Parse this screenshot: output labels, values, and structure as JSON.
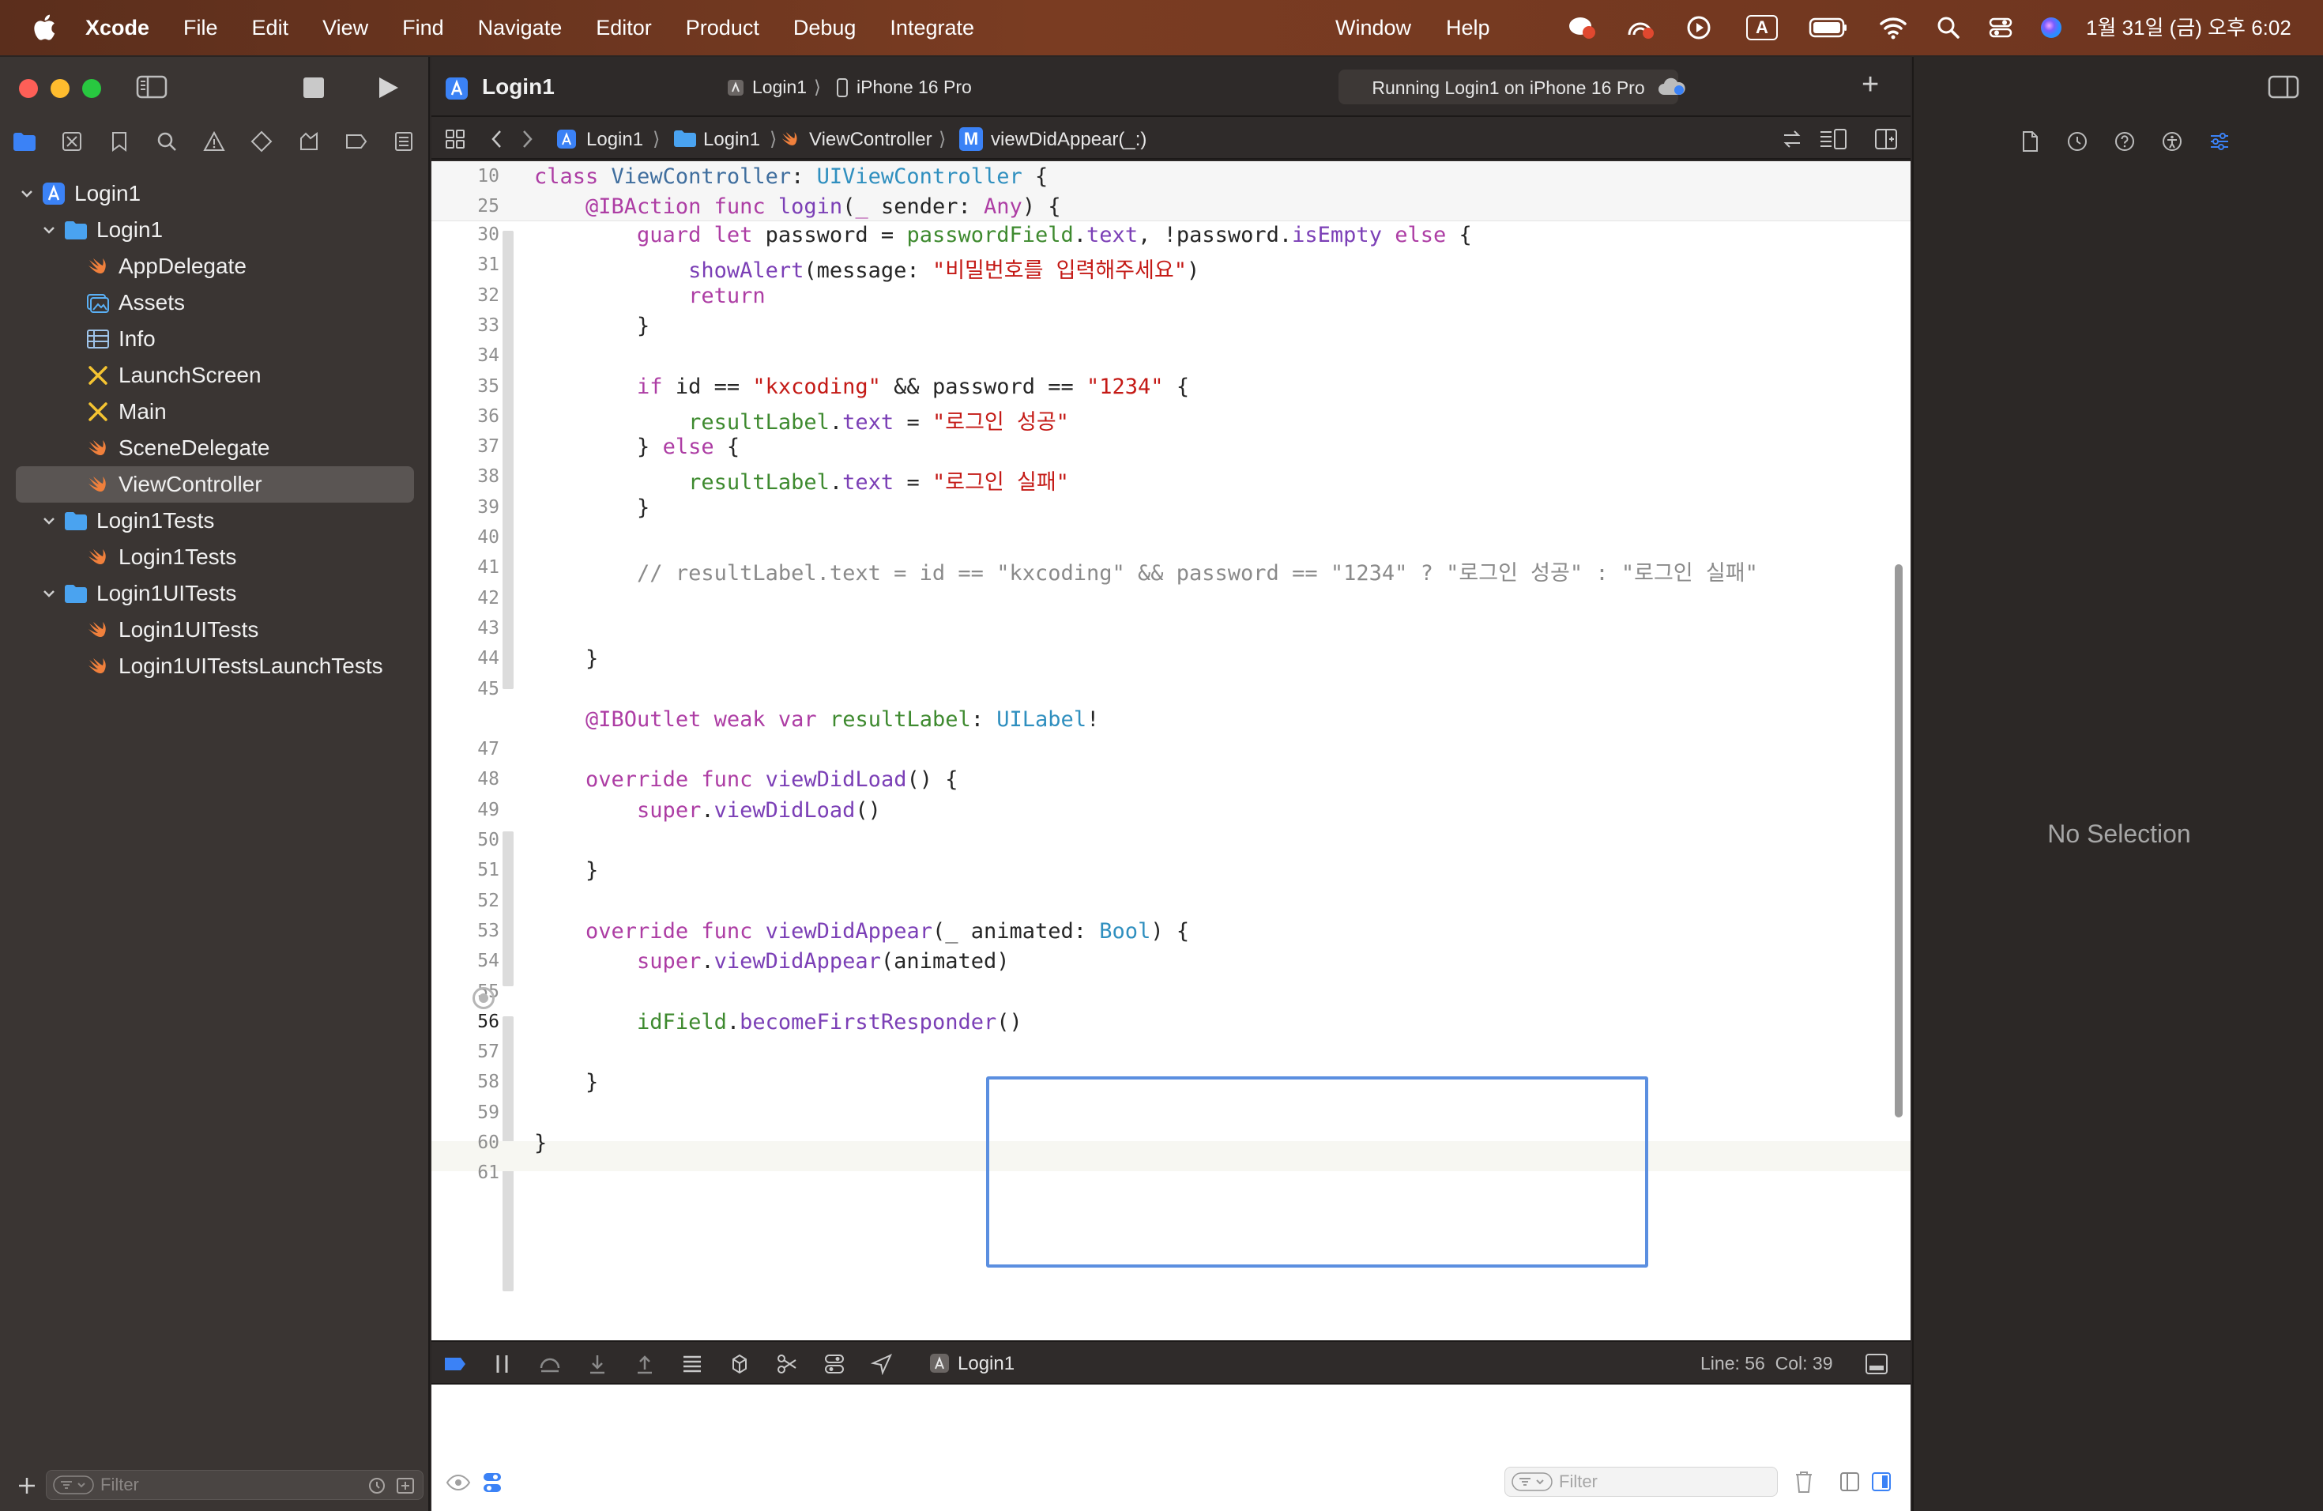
{
  "menubar": {
    "app": "Xcode",
    "items": [
      "File",
      "Edit",
      "View",
      "Find",
      "Navigate",
      "Editor",
      "Product",
      "Debug",
      "Integrate"
    ],
    "right_items": [
      "Window",
      "Help"
    ],
    "clock": "1월 31일 (금) 오후 6:02",
    "input_indicator": "A"
  },
  "toolbar": {
    "project_title": "Login1",
    "scheme": "Login1",
    "destination": "iPhone 16 Pro",
    "status": "Running Login1 on iPhone 16 Pro",
    "add_label": "+"
  },
  "navigator": {
    "tree": [
      {
        "label": "Login1",
        "kind": "project",
        "level": 0,
        "expanded": true
      },
      {
        "label": "Login1",
        "kind": "folder",
        "level": 1,
        "expanded": true
      },
      {
        "label": "AppDelegate",
        "kind": "swift",
        "level": 2
      },
      {
        "label": "Assets",
        "kind": "assets",
        "level": 2
      },
      {
        "label": "Info",
        "kind": "plist",
        "level": 2
      },
      {
        "label": "LaunchScreen",
        "kind": "storyboard",
        "level": 2
      },
      {
        "label": "Main",
        "kind": "storyboard",
        "level": 2
      },
      {
        "label": "SceneDelegate",
        "kind": "swift",
        "level": 2
      },
      {
        "label": "ViewController",
        "kind": "swift",
        "level": 2,
        "selected": true
      },
      {
        "label": "Login1Tests",
        "kind": "folder",
        "level": 1,
        "expanded": true
      },
      {
        "label": "Login1Tests",
        "kind": "swift",
        "level": 2
      },
      {
        "label": "Login1UITests",
        "kind": "folder",
        "level": 1,
        "expanded": true
      },
      {
        "label": "Login1UITests",
        "kind": "swift",
        "level": 2
      },
      {
        "label": "Login1UITestsLaunchTests",
        "kind": "swift",
        "level": 2
      }
    ],
    "filter_placeholder": "Filter"
  },
  "jumpbar": {
    "crumbs": [
      "Login1",
      "Login1",
      "ViewController",
      "viewDidAppear(_:)"
    ],
    "method_badge": "M"
  },
  "editor": {
    "sticky": [
      {
        "num": "10",
        "text": "class ViewController: UIViewController {"
      },
      {
        "num": "25",
        "text": "    @IBAction func login(_ sender: Any) {"
      }
    ],
    "lines": [
      {
        "num": "30",
        "text": "        guard let password = passwordField.text, !password.isEmpty else {"
      },
      {
        "num": "31",
        "text": "            showAlert(message: \"비밀번호를 입력해주세요\")"
      },
      {
        "num": "32",
        "text": "            return"
      },
      {
        "num": "33",
        "text": "        }"
      },
      {
        "num": "34",
        "text": ""
      },
      {
        "num": "35",
        "text": "        if id == \"kxcoding\" && password == \"1234\" {"
      },
      {
        "num": "36",
        "text": "            resultLabel.text = \"로그인 성공\""
      },
      {
        "num": "37",
        "text": "        } else {"
      },
      {
        "num": "38",
        "text": "            resultLabel.text = \"로그인 실패\""
      },
      {
        "num": "39",
        "text": "        }"
      },
      {
        "num": "40",
        "text": ""
      },
      {
        "num": "41",
        "text": "        // resultLabel.text = id == \"kxcoding\" && password == \"1234\" ? \"로그인 성공\" : \"로그인 실패\""
      },
      {
        "num": "42",
        "text": ""
      },
      {
        "num": "43",
        "text": ""
      },
      {
        "num": "44",
        "text": "    }"
      },
      {
        "num": "45",
        "text": ""
      },
      {
        "num": "",
        "text": "    @IBOutlet weak var resultLabel: UILabel!"
      },
      {
        "num": "47",
        "text": ""
      },
      {
        "num": "48",
        "text": "    override func viewDidLoad() {"
      },
      {
        "num": "49",
        "text": "        super.viewDidLoad()"
      },
      {
        "num": "50",
        "text": ""
      },
      {
        "num": "51",
        "text": "    }"
      },
      {
        "num": "52",
        "text": ""
      },
      {
        "num": "53",
        "text": "    override func viewDidAppear(_ animated: Bool) {"
      },
      {
        "num": "54",
        "text": "        super.viewDidAppear(animated)"
      },
      {
        "num": "55",
        "text": ""
      },
      {
        "num": "56",
        "text": "        idField.becomeFirstResponder()"
      },
      {
        "num": "57",
        "text": ""
      },
      {
        "num": "58",
        "text": "    }"
      },
      {
        "num": "59",
        "text": ""
      },
      {
        "num": "60",
        "text": "}"
      },
      {
        "num": "61",
        "text": ""
      }
    ],
    "current_line": "56"
  },
  "debugbar": {
    "target": "Login1",
    "position": "Line: 56  Col: 39"
  },
  "console": {
    "filter_placeholder": "Filter"
  },
  "inspector": {
    "empty_text": "No Selection"
  },
  "colors": {
    "accent": "#3b82f6",
    "swift_orange": "#f0803c",
    "folder_blue": "#4aa3f0",
    "highlight_box": "#5b8fe0"
  }
}
